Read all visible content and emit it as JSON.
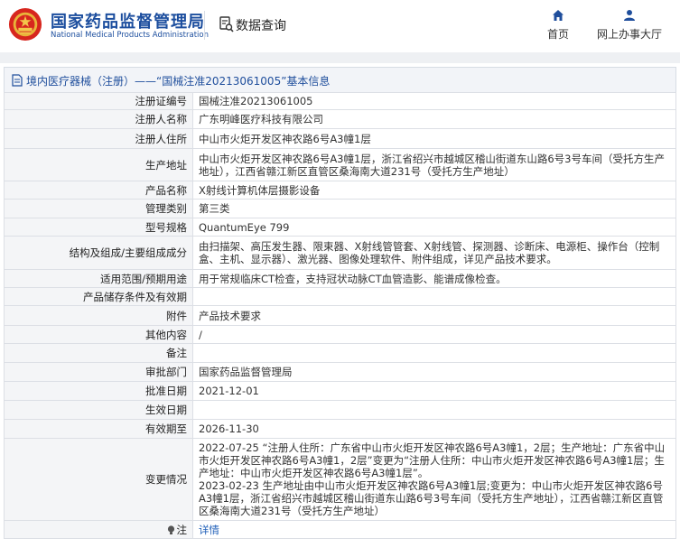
{
  "header": {
    "org_cn": "国家药品监督管理局",
    "org_en": "National Medical Products Administration",
    "query_label": "数据查询",
    "nav_home": "首页",
    "nav_online": "网上办事大厅"
  },
  "titlebar": {
    "text": "境内医疗器械（注册）——“国械注准20213061005”基本信息"
  },
  "rows": [
    {
      "label": "注册证编号",
      "value": "国械注准20213061005"
    },
    {
      "label": "注册人名称",
      "value": "广东明峰医疗科技有限公司"
    },
    {
      "label": "注册人住所",
      "value": "中山市火炬开发区神农路6号A3幢1层"
    },
    {
      "label": "生产地址",
      "value": "中山市火炬开发区神农路6号A3幢1层，浙江省绍兴市越城区稽山街道东山路6号3号车间（受托方生产地址），江西省赣江新区直管区桑海南大道231号（受托方生产地址）"
    },
    {
      "label": "产品名称",
      "value": "X射线计算机体层摄影设备"
    },
    {
      "label": "管理类别",
      "value": "第三类"
    },
    {
      "label": "型号规格",
      "value": "QuantumEye 799"
    },
    {
      "label": "结构及组成/主要组成成分",
      "value": "由扫描架、高压发生器、限束器、X射线管管套、X射线管、探测器、诊断床、电源柜、操作台（控制盒、主机、显示器）、激光器、图像处理软件、附件组成，详见产品技术要求。"
    },
    {
      "label": "适用范围/预期用途",
      "value": "用于常规临床CT检查，支持冠状动脉CT血管造影、能谱成像检查。"
    },
    {
      "label": "产品储存条件及有效期",
      "value": ""
    },
    {
      "label": "附件",
      "value": "产品技术要求"
    },
    {
      "label": "其他内容",
      "value": "/"
    },
    {
      "label": "备注",
      "value": ""
    },
    {
      "label": "审批部门",
      "value": "国家药品监督管理局"
    },
    {
      "label": "批准日期",
      "value": "2021-12-01"
    },
    {
      "label": "生效日期",
      "value": ""
    },
    {
      "label": "有效期至",
      "value": "2026-11-30"
    },
    {
      "label": "变更情况",
      "value": "2022-07-25 “注册人住所：广东省中山市火炬开发区神农路6号A3幢1，2层；生产地址：广东省中山市火炬开发区神农路6号A3幢1，2层”变更为“注册人住所：中山市火炬开发区神农路6号A3幢1层；生产地址：中山市火炬开发区神农路6号A3幢1层”。\n2023-02-23 生产地址由中山市火炬开发区神农路6号A3幢1层;变更为：中山市火炬开发区神农路6号A3幢1层，浙江省绍兴市越城区稽山街道东山路6号3号车间（受托方生产地址），江西省赣江新区直管区桑海南大道231号（受托方生产地址）"
    }
  ],
  "note": {
    "label": "注",
    "link": "详情"
  },
  "colors": {
    "brand": "#1c4e9e",
    "accent_red": "#d7261e",
    "label_bg": "#f4f5f7",
    "border": "#dcdfe5",
    "link": "#1f5fb8"
  }
}
